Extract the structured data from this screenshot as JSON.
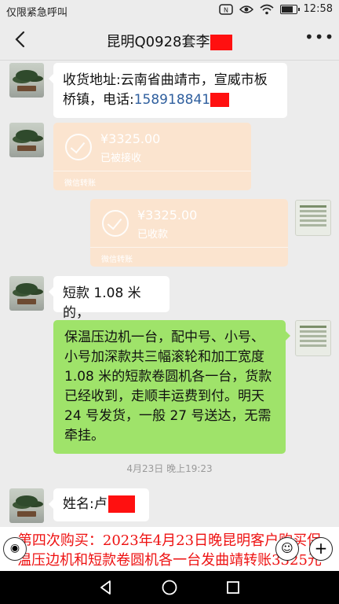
{
  "status_bar": {
    "carrier": "仅限紧急呼叫",
    "time": "12:58",
    "battery_level": 0.8
  },
  "header": {
    "title": "昆明Q0928套李"
  },
  "messages": {
    "address": {
      "text": "收货地址:云南省曲靖市，宣威市板桥镇，电话:",
      "phone": "158918841"
    },
    "transfer_received_left": {
      "amount": "¥3325.00",
      "status": "已被接收",
      "label": "微信转账"
    },
    "transfer_received_right": {
      "amount": "¥3325.00",
      "status": "已收款",
      "label": "微信转账"
    },
    "short": {
      "text": "短款 1.08 米的，"
    },
    "order": {
      "text": "保温压边机一台，配中号、小号、小号加深款共三幅滚轮和加工宽度 1.08 米的短款卷圆机各一台，货款已经收到，走顺丰运费到付。明天 24 号发货，一般 27 号送达，无需牵挂。"
    },
    "timestamp": "4月23日 晚上19:23",
    "name": {
      "text": "姓名:卢"
    }
  },
  "caption": {
    "line1": "第四次购买：2023年4月23日晚昆明客户购买保",
    "line2": "温压边机和短款卷圆机各一台发曲靖转账3325元"
  },
  "icons": {
    "back": "back-arrow-icon",
    "more": "more-icon",
    "voice": "voice-icon",
    "emoji": "emoji-icon",
    "plus": "plus-icon",
    "nav_back": "nav-back-icon",
    "nav_home": "nav-home-icon",
    "nav_recent": "nav-recent-icon"
  },
  "colors": {
    "redaction": "#ff1010",
    "green_bubble": "#9fe36a",
    "transfer_bg": "#fbe4cf",
    "caption_text": "#ee1111"
  }
}
